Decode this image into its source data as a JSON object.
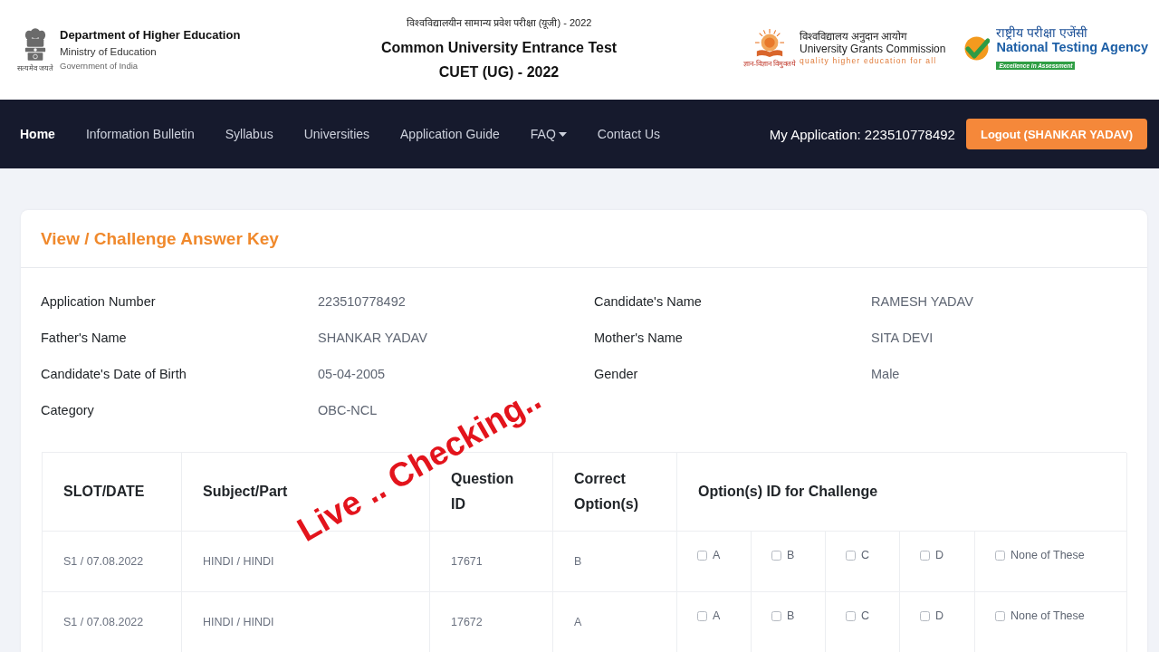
{
  "header": {
    "emblem_motto": "सत्यमेव जयते",
    "department": "Department of Higher Education",
    "ministry": "Ministry of Education",
    "government": "Government of India",
    "exam_title_hindi": "विश्वविद्यालयीन सामान्य प्रवेश परीक्षा (यूजी) - 2022",
    "exam_title": "Common University Entrance Test",
    "exam_code": "CUET (UG) - 2022",
    "ugc": {
      "motto": "ज्ञान-विज्ञान विमुक्तये",
      "name_hindi": "विश्वविद्यालय अनुदान आयोग",
      "name": "University Grants Commission",
      "tagline": "quality higher education for all"
    },
    "nta": {
      "name_hindi": "राष्ट्रीय परीक्षा एजेंसी",
      "name": "National Testing Agency",
      "tagline": "Excellence in Assessment"
    }
  },
  "nav": {
    "items": [
      {
        "label": "Home",
        "kind": "link",
        "selected": true
      },
      {
        "label": "Information Bulletin",
        "kind": "link",
        "selected": false
      },
      {
        "label": "Syllabus",
        "kind": "link",
        "selected": false
      },
      {
        "label": "Universities",
        "kind": "link",
        "selected": false
      },
      {
        "label": "Application Guide",
        "kind": "link",
        "selected": false
      },
      {
        "label": "FAQ",
        "kind": "dropdown",
        "selected": false
      },
      {
        "label": "Contact Us",
        "kind": "link",
        "selected": false
      }
    ],
    "application": "My Application: 223510778492",
    "logout": "Logout (SHANKAR YADAV)"
  },
  "card": {
    "title": "View / Challenge Answer Key",
    "details": [
      {
        "label": "Application Number",
        "value": "223510778492"
      },
      {
        "label": "Candidate's Name",
        "value": "RAMESH YADAV"
      },
      {
        "label": "Father's Name",
        "value": "SHANKAR YADAV"
      },
      {
        "label": "Mother's Name",
        "value": "SITA DEVI"
      },
      {
        "label": "Candidate's Date of Birth",
        "value": "05-04-2005"
      },
      {
        "label": "Gender",
        "value": "Male"
      },
      {
        "label": "Category",
        "value": "OBC-NCL"
      }
    ],
    "table": {
      "columns": [
        "SLOT/DATE",
        "Subject/Part",
        "Question ID",
        "Correct Option(s)",
        "Option(s) ID for Challenge"
      ],
      "rows": [
        {
          "slot_date": "S1 / 07.08.2022",
          "subject_part": "HINDI / HINDI",
          "question_id": "17671",
          "correct_options": "B",
          "options": [
            {
              "label": "A",
              "checked": false
            },
            {
              "label": "B",
              "checked": false
            },
            {
              "label": "C",
              "checked": false
            },
            {
              "label": "D",
              "checked": false
            },
            {
              "label": "None of These",
              "checked": false
            }
          ]
        },
        {
          "slot_date": "S1 / 07.08.2022",
          "subject_part": "HINDI / HINDI",
          "question_id": "17672",
          "correct_options": "A",
          "options": [
            {
              "label": "A",
              "checked": false
            },
            {
              "label": "B",
              "checked": false
            },
            {
              "label": "C",
              "checked": false
            },
            {
              "label": "D",
              "checked": false
            },
            {
              "label": "None of These",
              "checked": false
            }
          ]
        }
      ]
    }
  },
  "overlay_caption": "Live .. Checking.."
}
